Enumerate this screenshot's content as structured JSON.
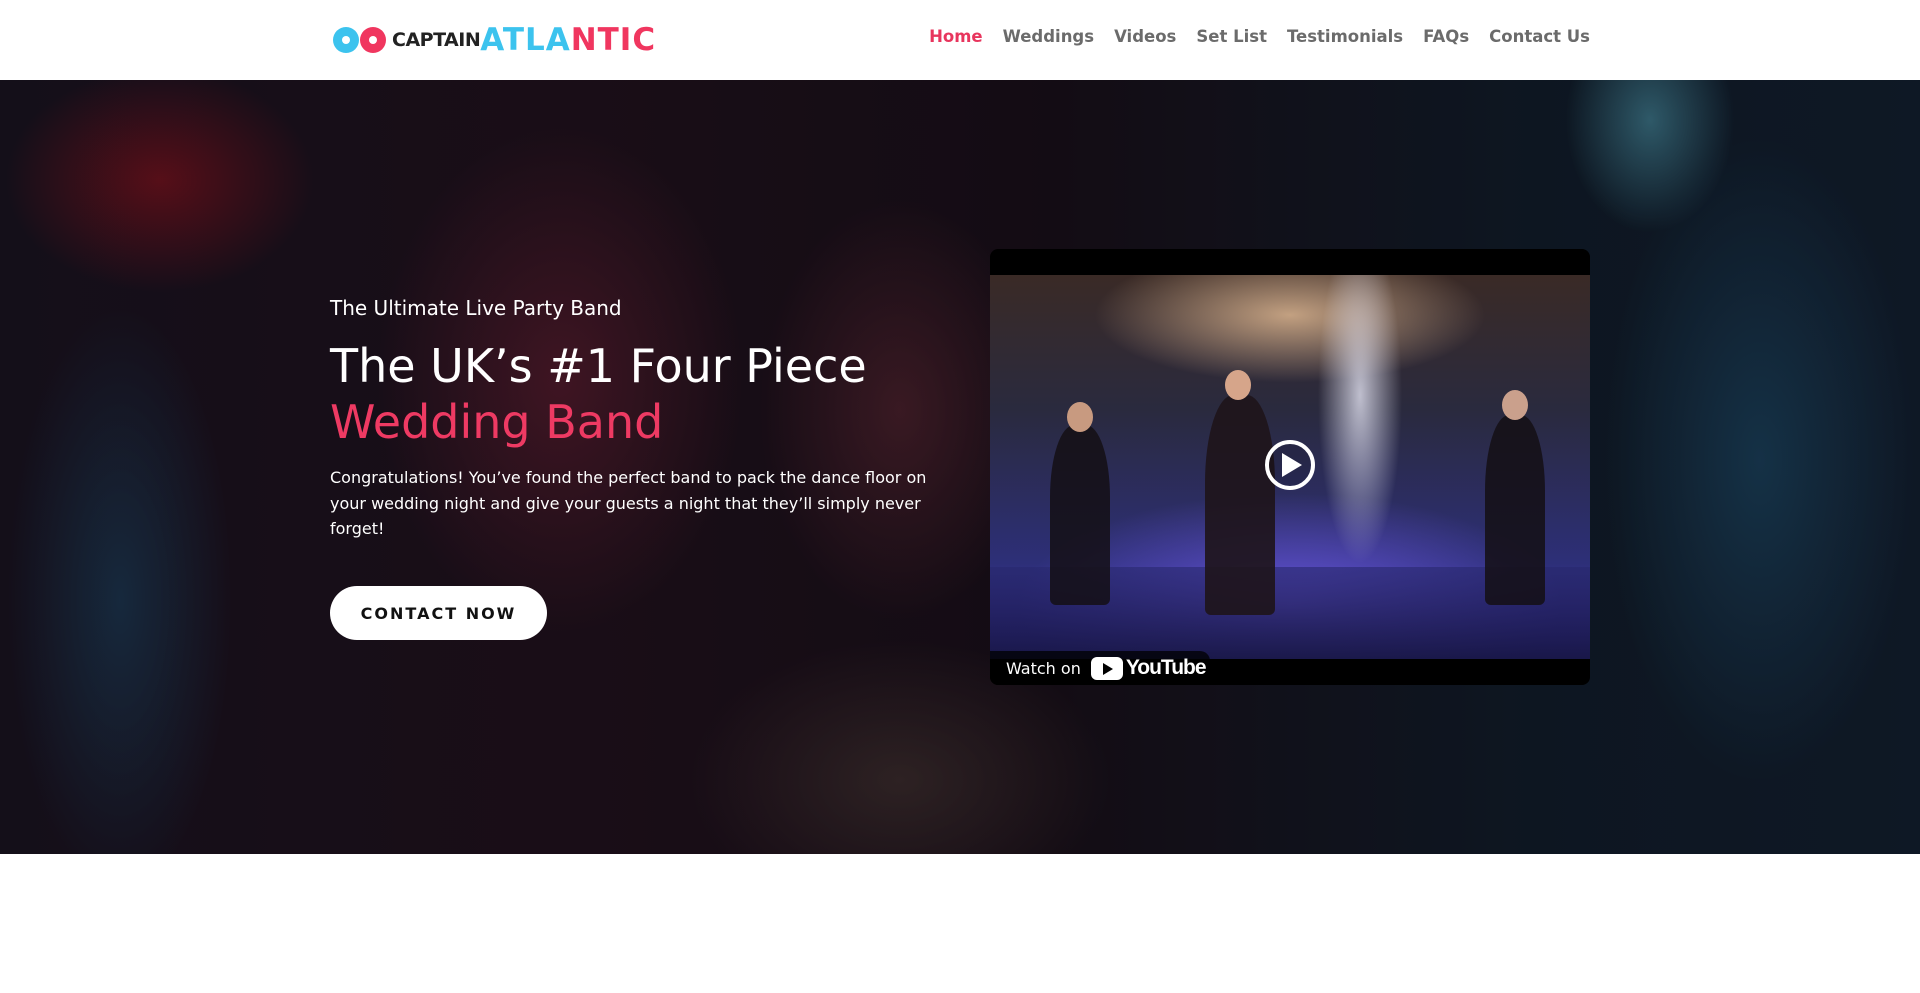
{
  "logo": {
    "captain": "CAPTAIN",
    "atlantic_part1": "ATLA",
    "atlantic_part2": "NTIC",
    "colors": {
      "blue": "#3cc3ee",
      "pink": "#f0365f"
    }
  },
  "nav": {
    "items": [
      {
        "label": "Home",
        "active": true
      },
      {
        "label": "Weddings"
      },
      {
        "label": "Videos"
      },
      {
        "label": "Set List"
      },
      {
        "label": "Testimonials"
      },
      {
        "label": "FAQs"
      },
      {
        "label": "Contact Us"
      }
    ],
    "active_color": "#e8355d"
  },
  "hero": {
    "eyebrow": "The Ultimate Live Party Band",
    "headline_line1": "The UK’s #1 Four Piece",
    "headline_line2": "Wedding Band",
    "body": "Congratulations! You’ve found the perfect band to pack the dance floor on your wedding night and give your guests a night that they’ll simply never forget!",
    "cta_label": "CONTACT NOW",
    "accent_color": "#ee3a63"
  },
  "video": {
    "watch_on_label": "Watch on",
    "youtube_wordmark": "YouTube",
    "play_icon": "play-icon"
  }
}
